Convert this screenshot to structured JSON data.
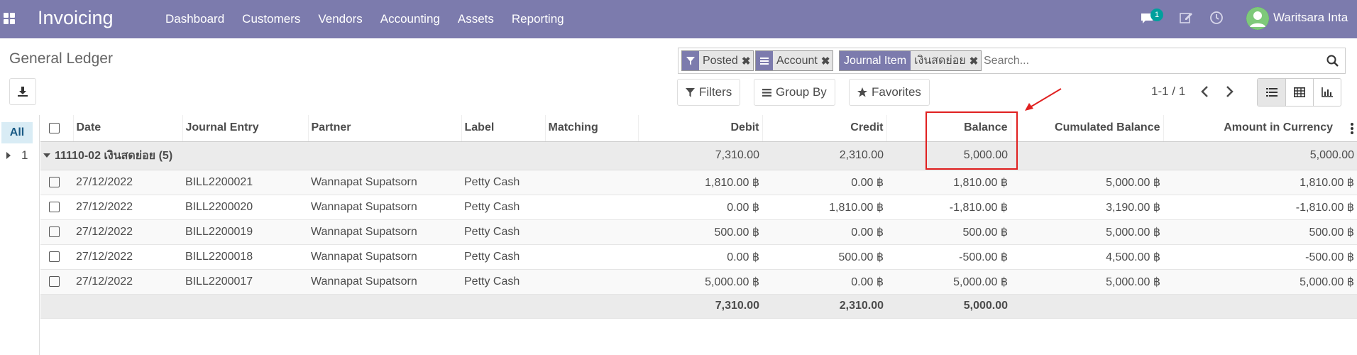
{
  "navbar": {
    "app_title": "Invoicing",
    "menu": [
      "Dashboard",
      "Customers",
      "Vendors",
      "Accounting",
      "Assets",
      "Reporting"
    ],
    "message_count": "1",
    "user_name": "Waritsara Inta"
  },
  "control_panel": {
    "page_title": "General Ledger",
    "facets": [
      {
        "label": "Posted",
        "icon": "filter-icon"
      },
      {
        "label": "Account",
        "icon": "list-icon"
      },
      {
        "group": "Journal Item",
        "value": "เงินสดย่อย"
      }
    ],
    "search_placeholder": "Search...",
    "filters_label": "Filters",
    "group_by_label": "Group By",
    "favorites_label": "Favorites",
    "pager": "1-1 / 1"
  },
  "side_panel": {
    "all_label": "All",
    "group_item": "1"
  },
  "table": {
    "columns": [
      "Date",
      "Journal Entry",
      "Partner",
      "Label",
      "Matching",
      "Debit",
      "Credit",
      "Balance",
      "Cumulated Balance",
      "Amount in Currency"
    ],
    "group": {
      "name": "11110-02 เงินสดย่อย (5)",
      "debit": "7,310.00",
      "credit": "2,310.00",
      "balance": "5,000.00",
      "amount_currency": "5,000.00"
    },
    "rows": [
      {
        "date": "27/12/2022",
        "entry": "BILL2200021",
        "partner": "Wannapat Supatsorn",
        "label": "Petty Cash",
        "debit": "1,810.00 ฿",
        "credit": "0.00 ฿",
        "balance": "1,810.00 ฿",
        "cumulated": "5,000.00 ฿",
        "currency": "1,810.00 ฿"
      },
      {
        "date": "27/12/2022",
        "entry": "BILL2200020",
        "partner": "Wannapat Supatsorn",
        "label": "Petty Cash",
        "debit": "0.00 ฿",
        "credit": "1,810.00 ฿",
        "balance": "-1,810.00 ฿",
        "cumulated": "3,190.00 ฿",
        "currency": "-1,810.00 ฿"
      },
      {
        "date": "27/12/2022",
        "entry": "BILL2200019",
        "partner": "Wannapat Supatsorn",
        "label": "Petty Cash",
        "debit": "500.00 ฿",
        "credit": "0.00 ฿",
        "balance": "500.00 ฿",
        "cumulated": "5,000.00 ฿",
        "currency": "500.00 ฿"
      },
      {
        "date": "27/12/2022",
        "entry": "BILL2200018",
        "partner": "Wannapat Supatsorn",
        "label": "Petty Cash",
        "debit": "0.00 ฿",
        "credit": "500.00 ฿",
        "balance": "-500.00 ฿",
        "cumulated": "4,500.00 ฿",
        "currency": "-500.00 ฿"
      },
      {
        "date": "27/12/2022",
        "entry": "BILL2200017",
        "partner": "Wannapat Supatsorn",
        "label": "Petty Cash",
        "debit": "5,000.00 ฿",
        "credit": "0.00 ฿",
        "balance": "5,000.00 ฿",
        "cumulated": "5,000.00 ฿",
        "currency": "5,000.00 ฿"
      }
    ],
    "totals": {
      "debit": "7,310.00",
      "credit": "2,310.00",
      "balance": "5,000.00"
    }
  },
  "colors": {
    "navbar": "#7c7bad",
    "annotation": "#e02020",
    "badge": "#00a09d"
  }
}
